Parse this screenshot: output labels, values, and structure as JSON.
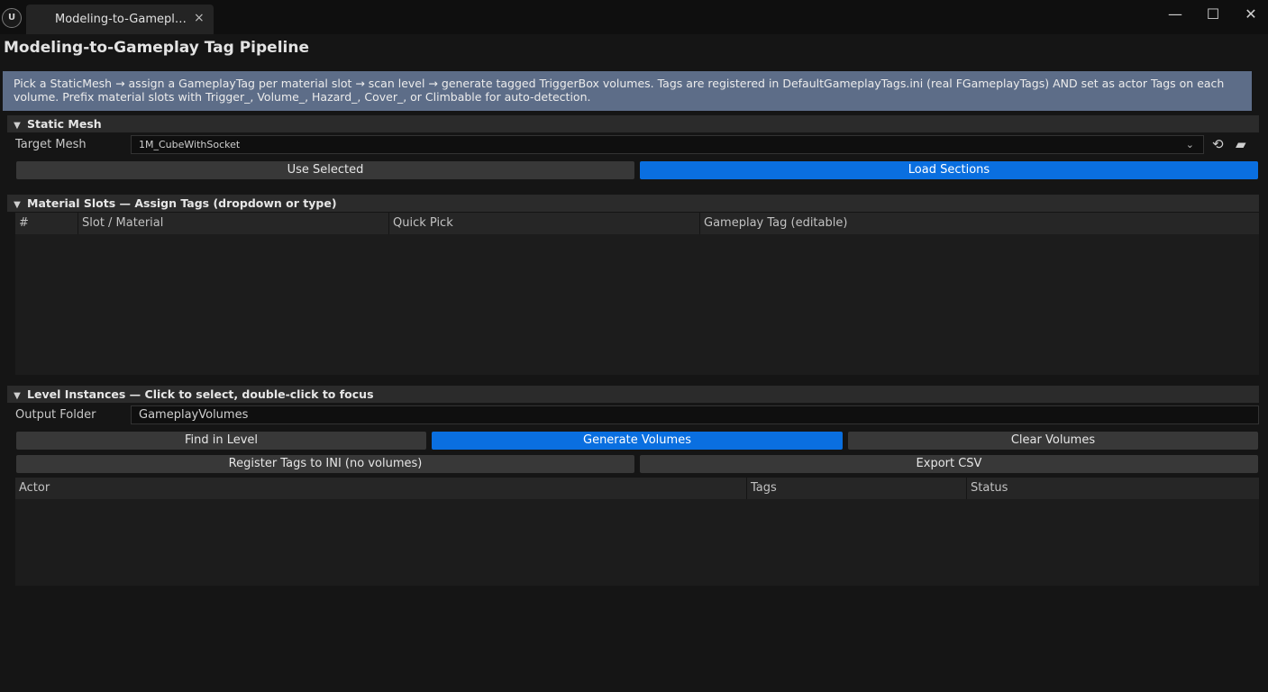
{
  "window": {
    "tab_label": "Modeling-to-Gameplay Tag Pipeline",
    "tab_close": "×",
    "minimize": "—",
    "maximize": "☐",
    "close": "✕"
  },
  "page_title": "Modeling-to-Gameplay Tag Pipeline",
  "info_text": "Pick a StaticMesh → assign a GameplayTag per material slot → scan level → generate tagged TriggerBox volumes. Tags are registered in DefaultGameplayTags.ini (real FGameplayTags) AND set as actor Tags on each volume. Prefix material slots with Trigger_, Volume_, Hazard_, Cover_, or Climbable for auto-detection.",
  "static_mesh": {
    "header": "Static Mesh",
    "target_label": "Target Mesh",
    "target_value": "1M_CubeWithSocket",
    "use_selected": "Use Selected",
    "load_sections": "Load Sections"
  },
  "material_slots": {
    "header": "Material Slots — Assign Tags (dropdown or type)",
    "columns": [
      "#",
      "Slot / Material",
      "Quick Pick",
      "Gameplay Tag (editable)"
    ],
    "rows": []
  },
  "level_instances": {
    "header": "Level Instances — Click to select, double-click to focus",
    "output_label": "Output Folder",
    "output_value": "GameplayVolumes",
    "find_in_level": "Find in Level",
    "generate_volumes": "Generate Volumes",
    "clear_volumes": "Clear Volumes",
    "register_tags": "Register Tags to INI (no volumes)",
    "export_csv": "Export CSV",
    "columns": [
      "Actor",
      "Tags",
      "Status"
    ],
    "rows": []
  },
  "colors": {
    "primary_button": "#0a6fe0",
    "info_background": "#5d6d88"
  }
}
